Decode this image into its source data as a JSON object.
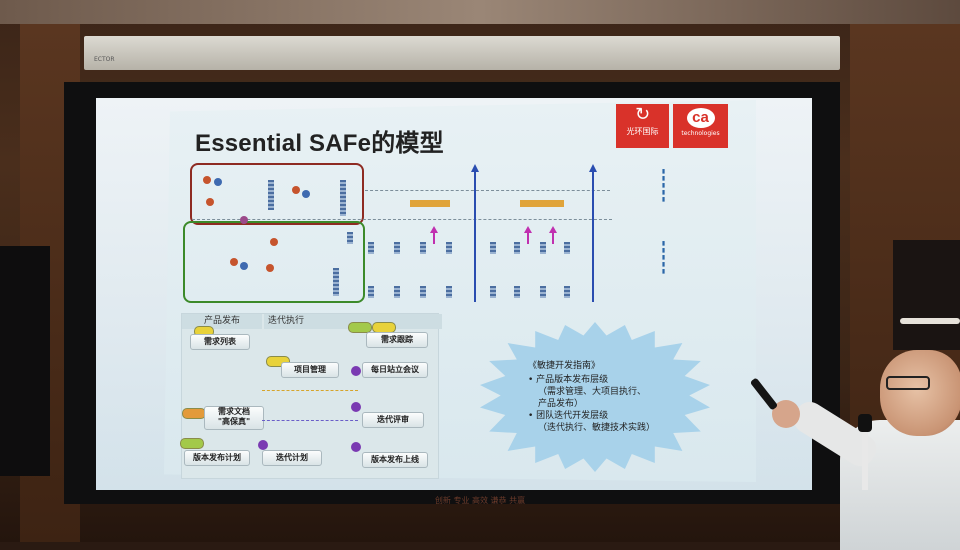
{
  "slide": {
    "title": "Essential SAFe的模型",
    "logo_left_text": "光环国际",
    "logo_right_brand": "ca",
    "logo_right_sub": "technologies"
  },
  "flow": {
    "header_left": "产品发布",
    "header_right": "迭代执行",
    "boxes": [
      "需求列表",
      "需求跟踪",
      "项目管理",
      "每日站立会议",
      "需求文档\n\"高保真\"",
      "迭代评审",
      "版本发布计划",
      "迭代计划",
      "版本发布上线"
    ]
  },
  "guide": {
    "title": "《敏捷开发指南》",
    "item1": "产品版本发布层级",
    "item1_detail": "（需求管理、大项目执行、产品发布）",
    "item2": "团队迭代开发层级",
    "item2_detail": "（迭代执行、敏捷技术实践）"
  },
  "footer_text": "创新 专业 高效 谦恭 共赢",
  "colors": {
    "slide_bg": "#dfe9ef",
    "logo_red": "#d9322a",
    "red_box": "#8e2b22",
    "green_box": "#3c8a2a",
    "blue_arrow": "#2a4db0",
    "magenta_arrow": "#c030b0",
    "starburst": "#a8d2ea"
  }
}
